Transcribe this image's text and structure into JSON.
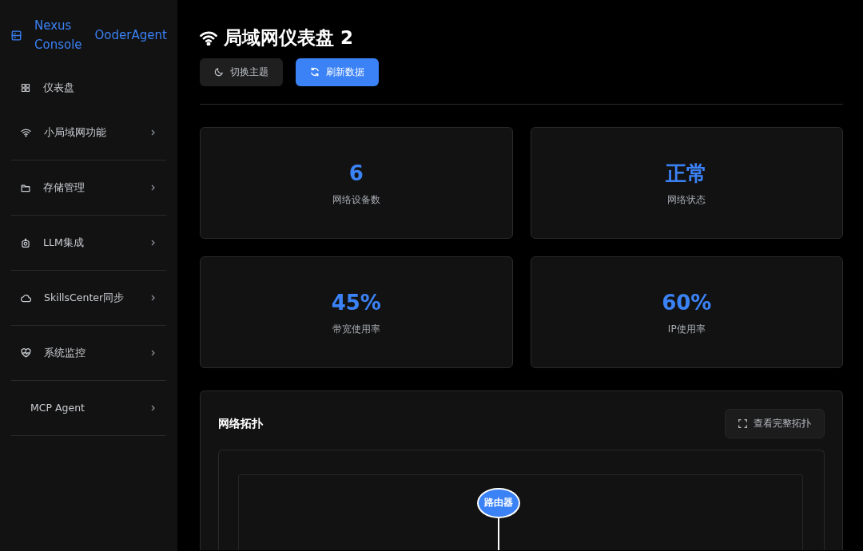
{
  "brand": {
    "title": "Nexus Console",
    "subtitle": "OoderAgent"
  },
  "nav": [
    {
      "label": "仪表盘",
      "has_submenu": false
    },
    {
      "label": "小局域网功能",
      "has_submenu": true
    },
    {
      "label": "存储管理",
      "has_submenu": true
    },
    {
      "label": "LLM集成",
      "has_submenu": true
    },
    {
      "label": "SkillsCenter同步",
      "has_submenu": true
    },
    {
      "label": "系统监控",
      "has_submenu": true
    },
    {
      "label": "MCP Agent",
      "has_submenu": true
    }
  ],
  "page": {
    "title": "局域网仪表盘 2",
    "buttons": [
      {
        "label": "切换主题",
        "kind": "secondary"
      },
      {
        "label": "刷新数据",
        "kind": "primary"
      }
    ]
  },
  "stats": [
    {
      "value": "6",
      "label": "网络设备数"
    },
    {
      "value": "正常",
      "label": "网络状态"
    },
    {
      "value": "45%",
      "label": "带宽使用率"
    },
    {
      "value": "60%",
      "label": "IP使用率"
    }
  ],
  "topology": {
    "title": "网络拓扑",
    "button": "查看完整拓扑",
    "nodes": [
      {
        "label": "路由器"
      }
    ]
  }
}
